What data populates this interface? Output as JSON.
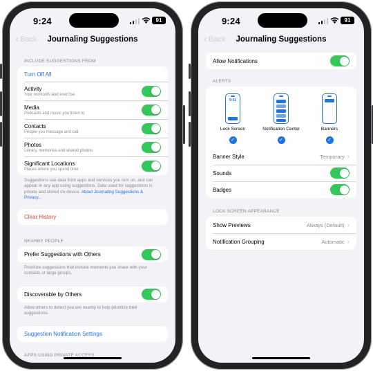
{
  "left": {
    "status": {
      "time": "9:24",
      "battery": "91"
    },
    "nav": {
      "back": "Back",
      "title": "Journaling Suggestions"
    },
    "include_header": "INCLUDE SUGGESTIONS FROM",
    "turn_off_all": "Turn Off All",
    "sources": [
      {
        "title": "Activity",
        "subtitle": "Your workouts and exercise",
        "on": true
      },
      {
        "title": "Media",
        "subtitle": "Podcasts and music you listen to",
        "on": true
      },
      {
        "title": "Contacts",
        "subtitle": "People you message and call",
        "on": true
      },
      {
        "title": "Photos",
        "subtitle": "Library, memories and shared photos",
        "on": true
      },
      {
        "title": "Significant Locations",
        "subtitle": "Places where you spend time",
        "on": true
      }
    ],
    "privacy_footer": "Suggestions use data from apps and services you turn on, and can appear in any app using suggestions. Data used for suggestions is private and stored on-device.",
    "privacy_link": "About Journaling Suggestions & Privacy...",
    "clear_history": "Clear History",
    "nearby_header": "NEARBY PEOPLE",
    "prefer_label": "Prefer Suggestions with Others",
    "prefer_footer": "Prioritize suggestions that include moments you share with your contacts or large groups.",
    "discoverable_label": "Discoverable by Others",
    "discoverable_footer": "Allow others to detect you are nearby to help prioritize their suggestions.",
    "notif_settings": "Suggestion Notification Settings",
    "private_header": "APPS USING PRIVATE ACCESS"
  },
  "right": {
    "status": {
      "time": "9:24",
      "battery": "91"
    },
    "nav": {
      "back": "Back",
      "title": "Journaling Suggestions"
    },
    "allow_notifications": "Allow Notifications",
    "alerts_header": "ALERTS",
    "alert_options": [
      {
        "label": "Lock Screen",
        "mini_time": "9:41",
        "checked": true
      },
      {
        "label": "Notification Center",
        "checked": true
      },
      {
        "label": "Banners",
        "checked": true
      }
    ],
    "banner_style": {
      "label": "Banner Style",
      "value": "Temporary"
    },
    "sounds": "Sounds",
    "badges": "Badges",
    "lock_header": "LOCK SCREEN APPEARANCE",
    "show_previews": {
      "label": "Show Previews",
      "value": "Always (Default)"
    },
    "grouping": {
      "label": "Notification Grouping",
      "value": "Automatic"
    }
  },
  "colors": {
    "accent": "#1a73e8",
    "toggle_on": "#34c759",
    "destructive": "#ff3b30",
    "background": "#f2f2f7"
  }
}
